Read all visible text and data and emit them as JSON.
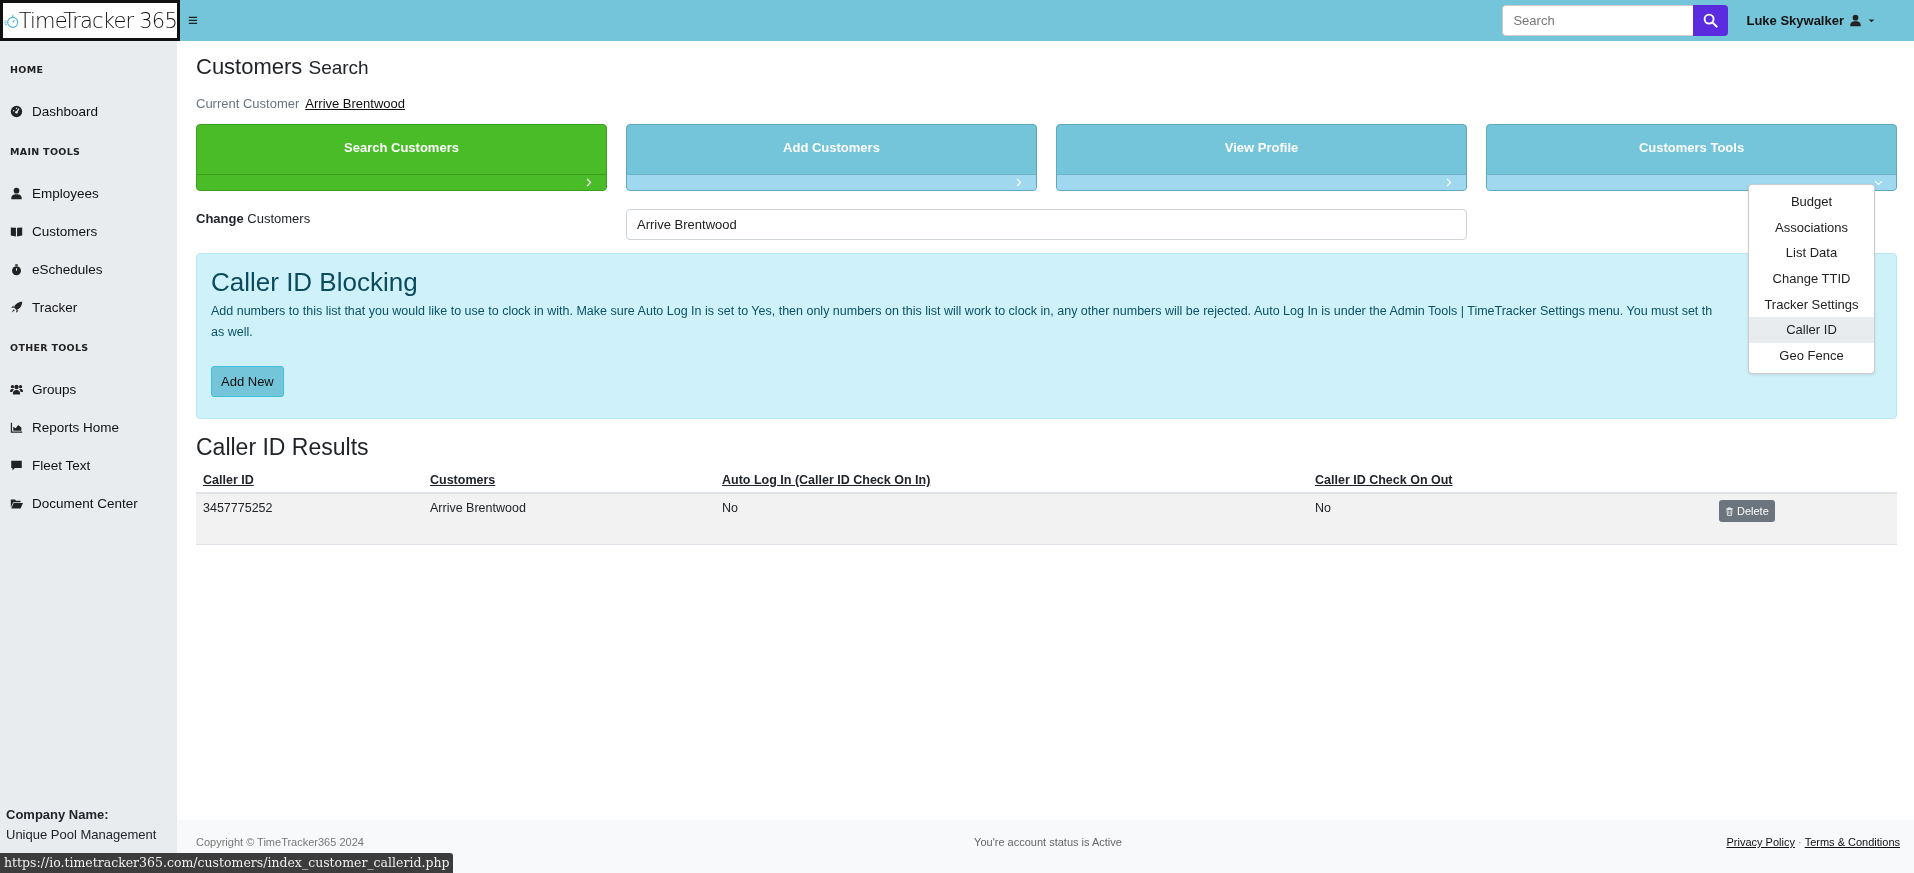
{
  "topbar": {
    "logo": "TimeTracker 365",
    "menu_glyph": "≡",
    "search": {
      "placeholder": "Search"
    },
    "user": "Luke Skywalker"
  },
  "sidebar": {
    "sections": [
      {
        "title": "HOME",
        "items": [
          {
            "label": "Dashboard"
          }
        ]
      },
      {
        "title": "MAIN TOOLS",
        "items": [
          {
            "label": "Employees"
          },
          {
            "label": "Customers"
          },
          {
            "label": "eSchedules"
          },
          {
            "label": "Tracker"
          }
        ]
      },
      {
        "title": "OTHER TOOLS",
        "items": [
          {
            "label": "Groups"
          },
          {
            "label": "Reports Home"
          },
          {
            "label": "Fleet Text"
          },
          {
            "label": "Document Center"
          }
        ]
      }
    ],
    "company_label": "Company Name:",
    "company": "Unique Pool Management"
  },
  "page": {
    "title": "Customers",
    "subtitle": "Search",
    "current_label": "Current Customer",
    "current_value": "Arrive Brentwood"
  },
  "cards": [
    {
      "label": "Search Customers",
      "selected": true,
      "kind": "link"
    },
    {
      "label": "Add Customers",
      "selected": false,
      "kind": "link"
    },
    {
      "label": "View Profile",
      "selected": false,
      "kind": "link"
    },
    {
      "label": "Customers Tools",
      "selected": false,
      "kind": "menu"
    }
  ],
  "change": {
    "label": "**Change** Customers",
    "value": "Arrive Brentwood"
  },
  "dropdown": [
    {
      "label": "Budget",
      "selected": false
    },
    {
      "label": "Associations",
      "selected": false
    },
    {
      "label": "List Data",
      "selected": false
    },
    {
      "label": "Change TTID",
      "selected": false
    },
    {
      "label": "Tracker Settings",
      "selected": false
    },
    {
      "label": "Caller ID",
      "selected": true
    },
    {
      "label": "Geo Fence",
      "selected": false
    }
  ],
  "notice": {
    "title": "Caller ID Blocking",
    "lines": [
      "Add numbers to this list that you would like to use to clock in with. Make sure Auto Log In is set to Yes, then only numbers on this list will work to clock in, any other numbers will be rejected. Auto Log In is under the Admin Tools | TimeTracker Settings menu. You must set th",
      "as well."
    ],
    "button": "Add New"
  },
  "results": {
    "title": "Caller ID Results",
    "columns": [
      "Caller ID",
      "Customers",
      "Auto Log In (Caller ID Check On In)",
      "Caller ID Check On Out"
    ],
    "rows": [
      {
        "cells": [
          "3457775252",
          "Arrive Brentwood",
          "No",
          "No"
        ],
        "action": "Delete"
      }
    ]
  },
  "footer": {
    "copyright": "Copyright © TimeTracker365 2024",
    "status": "You're account status is Active",
    "links": [
      "Privacy Policy",
      "Terms & Conditions"
    ],
    "separator": "·"
  },
  "status_url": "https://io.timetracker365.com/customers/index_customer_callerid.php"
}
